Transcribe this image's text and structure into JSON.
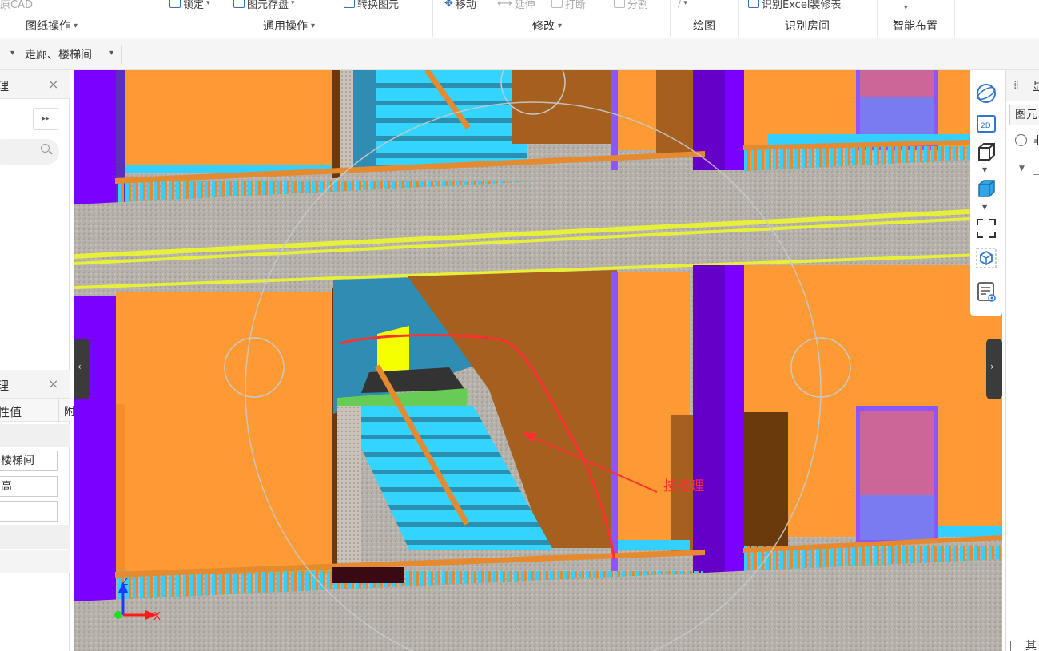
{
  "ribbon": {
    "cad_label": "原CAD",
    "tools": {
      "lock": "锁定",
      "save_element": "图元存盘",
      "convert_element": "转换图元",
      "move": "移动",
      "extend": "延伸",
      "break": "打断",
      "split": "分割",
      "recognize_excel": "识别Excel装修表"
    },
    "groups": {
      "drawing_ops": "图纸操作",
      "common_ops": "通用操作",
      "modify": "修改",
      "draw": "绘图",
      "recognize_room": "识别房间",
      "smart_layout": "智能布置"
    }
  },
  "filterbar": {
    "category": "走廊、楼梯间"
  },
  "left_panel": {
    "top_title": "理",
    "bottom_title": "理",
    "prop_col_header": "性值",
    "prop_col2": "附",
    "fields": [
      "楼梯间",
      "高",
      ""
    ],
    "expand_glyph": "▸▸",
    "close_glyph": "×"
  },
  "viewport": {
    "annotation": "按道理",
    "axis_z": "Z",
    "axis_x": "X",
    "colors": {
      "wall_orange": "#fd9a33",
      "column_purple": "#7a00ff",
      "stair_cyan": "#33d4ff",
      "railing_orange": "#e58a2e",
      "slab_gray": "#b7b2ab",
      "beam_yellow": "#e6f03a",
      "door_pink": "#cc6699",
      "window_blue": "#7b7bf0",
      "landing_green": "#66cc55",
      "annotation_red": "#ff3030"
    }
  },
  "view_tools": [
    "orbit-icon",
    "2d-icon",
    "box-view-icon",
    "solid-view-icon",
    "fullscreen-icon",
    "element-display-icon",
    "properties-icon"
  ],
  "right_panel": {
    "title": "显",
    "tab": "图元",
    "radio_label": "非",
    "checkbox_label": "其他"
  }
}
